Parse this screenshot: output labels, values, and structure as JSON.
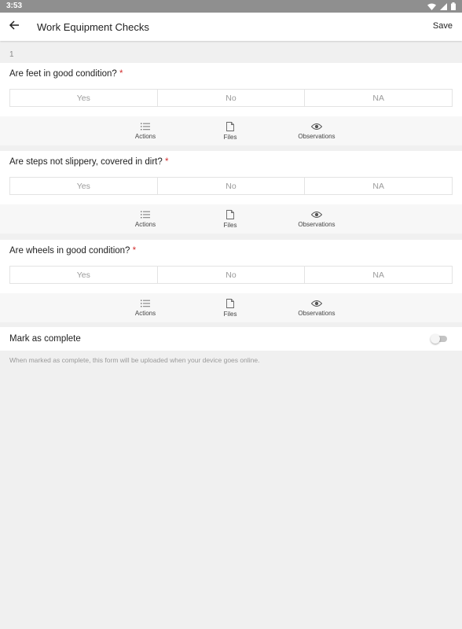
{
  "status_bar": {
    "time": "3:53",
    "icons": [
      "wifi-icon",
      "signal-icon",
      "battery-icon"
    ]
  },
  "app_bar": {
    "back_icon": "arrow-left-icon",
    "title": "Work Equipment Checks",
    "save_label": "Save"
  },
  "section": {
    "number": "1"
  },
  "questions": [
    {
      "text": "Are feet in good condition?",
      "required_mark": "*",
      "options": [
        "Yes",
        "No",
        "NA"
      ],
      "actions": [
        {
          "label": "Actions",
          "icon": "list-icon"
        },
        {
          "label": "Files",
          "icon": "file-icon"
        },
        {
          "label": "Observations",
          "icon": "eye-icon"
        }
      ]
    },
    {
      "text": "Are steps not slippery, covered in dirt?",
      "required_mark": "*",
      "options": [
        "Yes",
        "No",
        "NA"
      ],
      "actions": [
        {
          "label": "Actions",
          "icon": "list-icon"
        },
        {
          "label": "Files",
          "icon": "file-icon"
        },
        {
          "label": "Observations",
          "icon": "eye-icon"
        }
      ]
    },
    {
      "text": "Are wheels in good condition?",
      "required_mark": "*",
      "options": [
        "Yes",
        "No",
        "NA"
      ],
      "actions": [
        {
          "label": "Actions",
          "icon": "list-icon"
        },
        {
          "label": "Files",
          "icon": "file-icon"
        },
        {
          "label": "Observations",
          "icon": "eye-icon"
        }
      ]
    }
  ],
  "complete": {
    "label": "Mark as complete",
    "enabled": false,
    "helper_text": "When marked as complete, this form will be uploaded when your device goes online."
  },
  "colors": {
    "required": "#d32f2f",
    "status_bar": "#8f8f8f",
    "background": "#f0f0f0"
  }
}
